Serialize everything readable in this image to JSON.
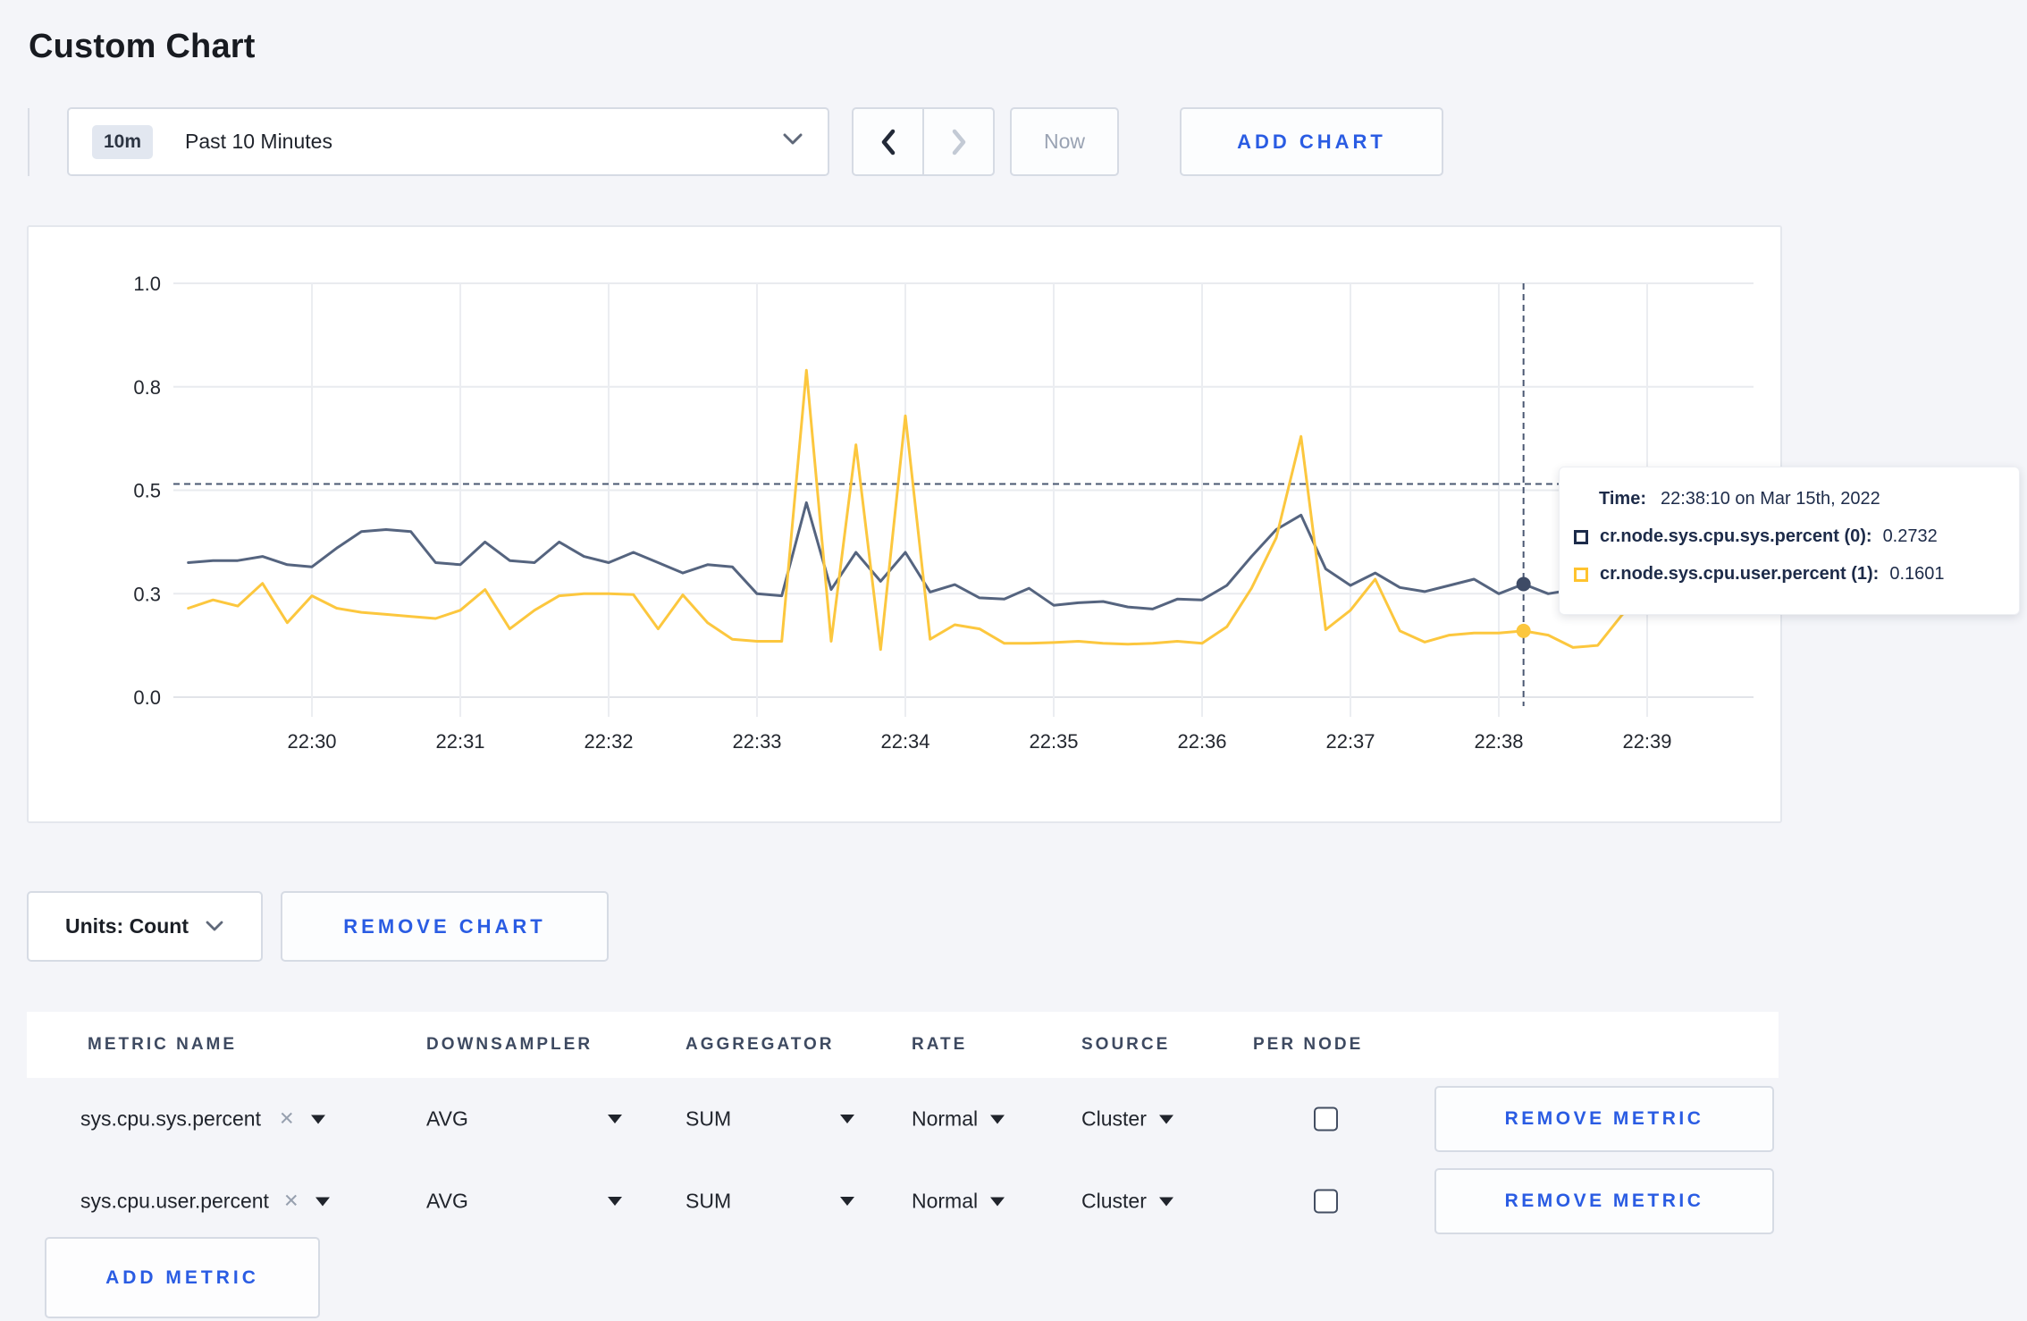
{
  "page": {
    "title": "Custom Chart"
  },
  "colors": {
    "accent_blue": "#2a5ce3",
    "page_background": "#f4f5f9",
    "series_sys": "#55647f",
    "series_sys_dot": "#3e4b66",
    "series_user": "#fcc73e",
    "crosshair": "#4a5872",
    "gridline": "#e9ebef"
  },
  "toolbar": {
    "time_selector": {
      "badge": "10m",
      "label": "Past 10 Minutes"
    },
    "prev_icon": "chevron-left",
    "next_icon": "chevron-right",
    "now_label": "Now",
    "add_chart_label": "ADD CHART"
  },
  "chart_data": {
    "type": "line",
    "title": "",
    "xlabel": "",
    "ylabel": "",
    "ylim": [
      0,
      1
    ],
    "grid": true,
    "legend_position": "tooltip-only",
    "start_time": "22:29:10",
    "interval_seconds": 10,
    "x_ticks": [
      "22:30",
      "22:31",
      "22:32",
      "22:33",
      "22:34",
      "22:35",
      "22:36",
      "22:37",
      "22:38",
      "22:39"
    ],
    "y_ticks": [
      {
        "label": "0.0",
        "value": 0
      },
      {
        "label": "0.3",
        "value": 0.25
      },
      {
        "label": "0.5",
        "value": 0.5
      },
      {
        "label": "0.8",
        "value": 0.75
      },
      {
        "label": "1.0",
        "value": 1.0
      }
    ],
    "series": [
      {
        "name": "cr.node.sys.cpu.sys.percent (0)",
        "color": "#55647f",
        "dot_color": "#3e4b66",
        "values": [
          0.325,
          0.33,
          0.33,
          0.34,
          0.32,
          0.315,
          0.36,
          0.4,
          0.405,
          0.4,
          0.325,
          0.32,
          0.375,
          0.33,
          0.325,
          0.375,
          0.34,
          0.325,
          0.35,
          0.325,
          0.3,
          0.32,
          0.315,
          0.25,
          0.245,
          0.47,
          0.26,
          0.35,
          0.28,
          0.35,
          0.254,
          0.272,
          0.24,
          0.237,
          0.263,
          0.222,
          0.228,
          0.231,
          0.218,
          0.213,
          0.237,
          0.235,
          0.27,
          0.34,
          0.405,
          0.44,
          0.31,
          0.27,
          0.3,
          0.265,
          0.255,
          0.27,
          0.285,
          0.25,
          0.2732,
          0.25,
          0.26,
          0.27,
          0.3,
          0.29,
          0.295,
          0.3,
          0.295
        ]
      },
      {
        "name": "cr.node.sys.cpu.user.percent (1)",
        "color": "#fcc73e",
        "dot_color": "#fcc73e",
        "values": [
          0.215,
          0.235,
          0.22,
          0.275,
          0.18,
          0.245,
          0.215,
          0.205,
          0.2,
          0.195,
          0.19,
          0.21,
          0.26,
          0.165,
          0.21,
          0.245,
          0.25,
          0.25,
          0.248,
          0.165,
          0.247,
          0.18,
          0.14,
          0.135,
          0.135,
          0.79,
          0.135,
          0.61,
          0.115,
          0.68,
          0.14,
          0.175,
          0.165,
          0.13,
          0.13,
          0.132,
          0.135,
          0.13,
          0.128,
          0.13,
          0.135,
          0.13,
          0.17,
          0.263,
          0.385,
          0.63,
          0.163,
          0.21,
          0.285,
          0.16,
          0.133,
          0.15,
          0.155,
          0.155,
          0.1601,
          0.15,
          0.12,
          0.125,
          0.2,
          0.235,
          0.26,
          0.24,
          0.245
        ]
      }
    ],
    "crosshair": {
      "time_index": 54,
      "time_label": "22:38:10",
      "y_value": 0.515
    }
  },
  "tooltip": {
    "time_label": "Time:",
    "time_value": "22:38:10 on Mar 15th, 2022",
    "series": [
      {
        "name": "cr.node.sys.cpu.sys.percent (0):",
        "value": "0.2732",
        "swatch_color": "#1c2b4a"
      },
      {
        "name": "cr.node.sys.cpu.user.percent (1):",
        "value": "0.1601",
        "swatch_color": "#ffc32e"
      }
    ]
  },
  "chart_controls": {
    "units_label": "Units: Count",
    "remove_chart_label": "REMOVE CHART"
  },
  "metrics_table": {
    "headers": {
      "metric_name": "METRIC NAME",
      "downsampler": "DOWNSAMPLER",
      "aggregator": "AGGREGATOR",
      "rate": "RATE",
      "source": "SOURCE",
      "per_node": "PER NODE"
    },
    "rows": [
      {
        "metric": "sys.cpu.sys.percent",
        "downsampler": "AVG",
        "aggregator": "SUM",
        "rate": "Normal",
        "source": "Cluster",
        "per_node_checked": false,
        "remove_label": "REMOVE METRIC"
      },
      {
        "metric": "sys.cpu.user.percent",
        "downsampler": "AVG",
        "aggregator": "SUM",
        "rate": "Normal",
        "source": "Cluster",
        "per_node_checked": false,
        "remove_label": "REMOVE METRIC"
      }
    ],
    "add_metric_label": "ADD METRIC"
  }
}
